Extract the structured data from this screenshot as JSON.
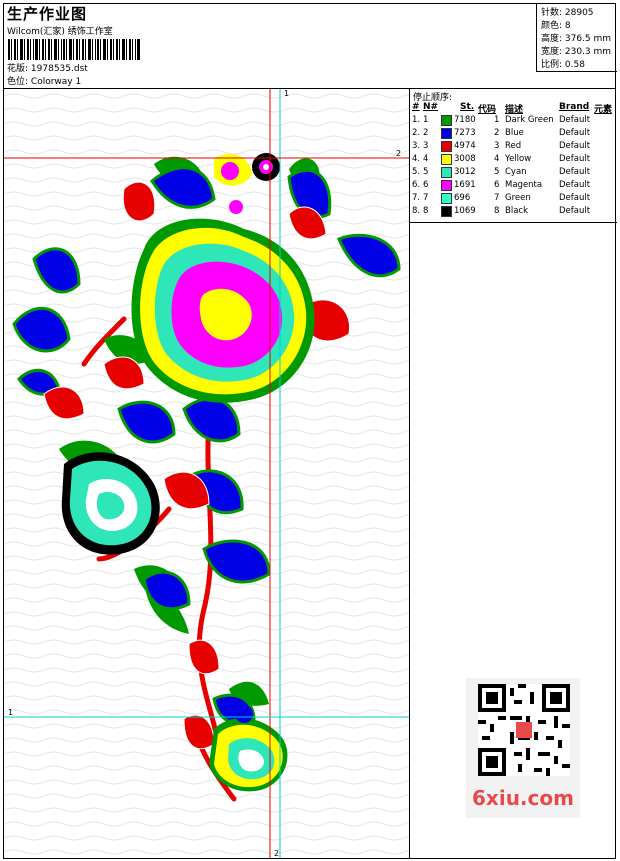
{
  "header": {
    "title": "生产作业图",
    "subtitle": "Wilcom(汇家) 绣饰工作室",
    "design_label": "花版:",
    "design_value": "1978535.dst",
    "colorway_label": "色位:",
    "colorway_value": "Colorway 1"
  },
  "stats": {
    "stitches": "针数: 28905",
    "colors": "颜色: 8",
    "height": "高度: 376.5 mm",
    "width": "宽度: 230.3 mm",
    "scale": "比例: 0.58"
  },
  "guides": {
    "v1_label": "1",
    "h2_label": "2",
    "h1_label": "1",
    "v2_label": "2"
  },
  "stop_sequence": {
    "title": "停止顺序:",
    "headers": [
      "#",
      "N#",
      "St.",
      "代码",
      "描述",
      "Brand",
      "元素"
    ],
    "rows": [
      {
        "idx": "1.",
        "n": "1",
        "color": "#009a00",
        "st": "7180",
        "code": "1",
        "desc": "Dark Green",
        "brand": "Default"
      },
      {
        "idx": "2.",
        "n": "2",
        "color": "#0000e6",
        "st": "7273",
        "code": "2",
        "desc": "Blue",
        "brand": "Default"
      },
      {
        "idx": "3.",
        "n": "3",
        "color": "#e60000",
        "st": "4974",
        "code": "3",
        "desc": "Red",
        "brand": "Default"
      },
      {
        "idx": "4.",
        "n": "4",
        "color": "#ffff00",
        "st": "3008",
        "code": "4",
        "desc": "Yellow",
        "brand": "Default"
      },
      {
        "idx": "5.",
        "n": "5",
        "color": "#2ee6b8",
        "st": "3012",
        "code": "5",
        "desc": "Cyan",
        "brand": "Default"
      },
      {
        "idx": "6.",
        "n": "6",
        "color": "#ff00ff",
        "st": "1691",
        "code": "6",
        "desc": "Magenta",
        "brand": "Default"
      },
      {
        "idx": "7.",
        "n": "7",
        "color": "#33ffcc",
        "st": "696",
        "code": "7",
        "desc": "Green",
        "brand": "Default"
      },
      {
        "idx": "8.",
        "n": "8",
        "color": "#000000",
        "st": "1069",
        "code": "8",
        "desc": "Black",
        "brand": "Default"
      }
    ]
  },
  "watermark": {
    "text": "6xiu.com"
  }
}
